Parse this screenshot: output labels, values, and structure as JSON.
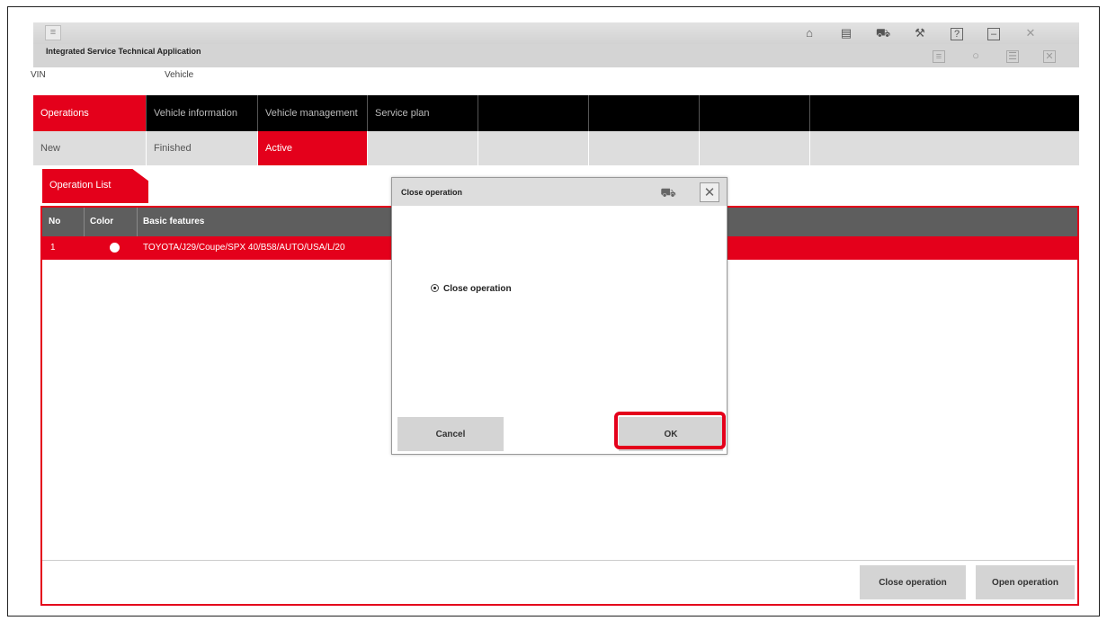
{
  "app": {
    "title": "Integrated Service Technical Application",
    "menu_icon": "menu-icon",
    "top_icons": [
      "home-icon",
      "id-card-icon",
      "vehicle-icon",
      "wrench-icon",
      "help-icon",
      "minimize-icon",
      "close-icon"
    ],
    "second_icons": [
      "notes-icon",
      "settings-icon",
      "list-icon",
      "close-icon"
    ]
  },
  "info": {
    "vin_label": "VIN",
    "vehicle_label": "Vehicle"
  },
  "tabs_main": [
    {
      "label": "Operations",
      "active": true
    },
    {
      "label": "Vehicle information",
      "active": false
    },
    {
      "label": "Vehicle management",
      "active": false
    },
    {
      "label": "Service plan",
      "active": false
    }
  ],
  "tabs_sub": [
    {
      "label": "New",
      "active": false
    },
    {
      "label": "Finished",
      "active": false
    },
    {
      "label": "Active",
      "active": true
    }
  ],
  "operation_list": {
    "tab_label": "Operation List",
    "columns": [
      "No",
      "Color",
      "Basic features"
    ],
    "rows": [
      {
        "no": "1",
        "color": "white",
        "features": "TOYOTA/J29/Coupe/SPX 40/B58/AUTO/USA/L/20"
      }
    ],
    "buttons": {
      "close_operation": "Close operation",
      "open_operation": "Open operation"
    }
  },
  "dialog": {
    "title": "Close operation",
    "option_label": "Close operation",
    "cancel_label": "Cancel",
    "ok_label": "OK"
  },
  "colors": {
    "accent": "#e4001b",
    "header_dark": "#5e5e5e",
    "tab_bar": "#000000",
    "button_gray": "#d4d4d4"
  }
}
